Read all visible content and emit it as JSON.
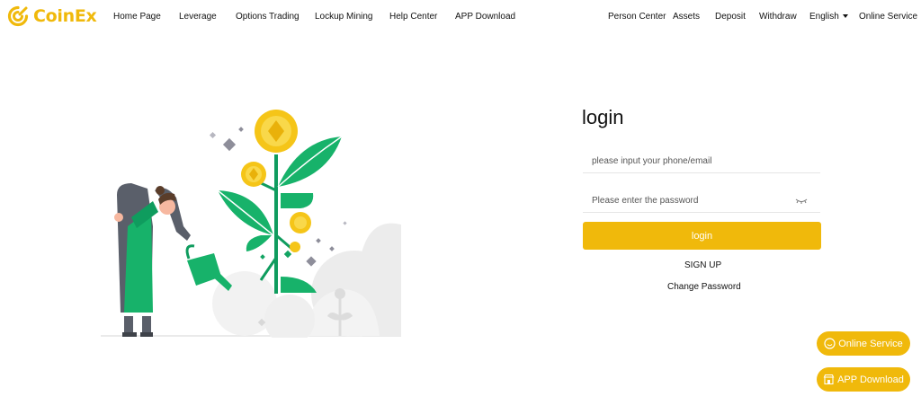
{
  "brand": {
    "name": "CoinEx",
    "color": "#f0b90b"
  },
  "nav_left": [
    "Home Page",
    "Leverage",
    "Options Trading",
    "Lockup Mining",
    "Help Center",
    "APP Download"
  ],
  "nav_right": {
    "person_center": "Person Center",
    "assets": "Assets",
    "deposit": "Deposit",
    "withdraw": "Withdraw",
    "language": "English",
    "online_service": "Online Service"
  },
  "login": {
    "title": "login",
    "account_placeholder": "please input your phone/email",
    "password_placeholder": "Please enter the password",
    "submit_label": "login",
    "signup_label": "SIGN UP",
    "change_password_label": "Change Password"
  },
  "floating": {
    "online_service": "Online Service",
    "app_download": "APP Download"
  },
  "icons": {
    "logo": "coinex-logo-icon",
    "password_toggle": "eye-closed-icon",
    "online_service": "chat-smile-icon",
    "app_download": "store-icon"
  }
}
